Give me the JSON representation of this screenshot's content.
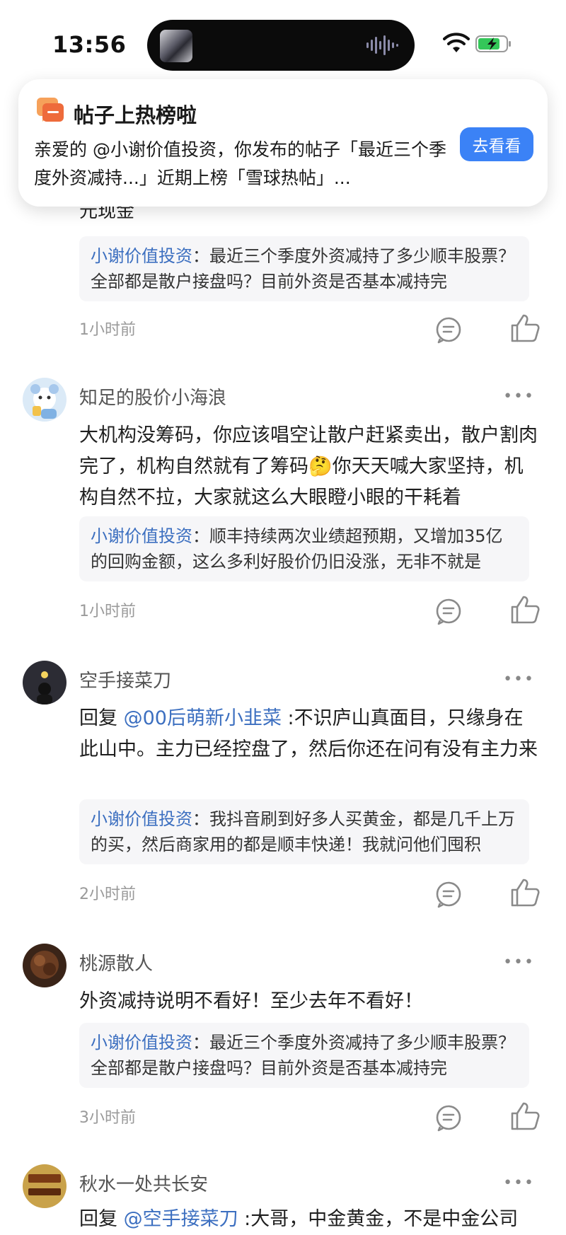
{
  "status_bar": {
    "time": "13:56"
  },
  "notification": {
    "title": "帖子上热榜啦",
    "body": "亲爱的 @小谢价值投资，你发布的帖子「最近三个季度外资减持...」近期上榜「雪球热帖」...",
    "button_label": "去看看"
  },
  "partial_text": "元现金",
  "comments": [
    {
      "quote_user": "小谢价值投资",
      "quote_text": "最近三个季度外资减持了多少顺丰股票？全部都是散户接盘吗？目前外资是否基本减持完",
      "time": "1小时前"
    },
    {
      "author": "知足的股价小海浪",
      "text_part1": "大机构没筹码，你应该唱空让散户赶紧卖出，散户割肉完了，机构自然就有了筹码",
      "emoji": "🤔",
      "text_part2": "你天天喊大家坚持，机构自然不拉，大家就这么大眼瞪小眼的干耗着",
      "quote_user": "小谢价值投资",
      "quote_text": "顺丰持续两次业绩超预期，又增加35亿的回购金额，这么多利好股价仍旧没涨，无非不就是",
      "time": "1小时前"
    },
    {
      "author": "空手接菜刀",
      "reply_prefix": "回复 ",
      "reply_to": "@00后萌新小韭菜",
      "text": " :不识庐山真面目，只缘身在此山中。主力已经控盘了，然后你还在问有没有主力来",
      "quote_user": "小谢价值投资",
      "quote_text": "我抖音刷到好多人买黄金，都是几千上万的买，然后商家用的都是顺丰快递！我就问他们囤积",
      "time": "2小时前"
    },
    {
      "author": "桃源散人",
      "text": "外资减持说明不看好！至少去年不看好！",
      "quote_user": "小谢价值投资",
      "quote_text": "最近三个季度外资减持了多少顺丰股票？全部都是散户接盘吗？目前外资是否基本减持完",
      "time": "3小时前"
    },
    {
      "author": "秋水一处共长安",
      "reply_prefix": "回复 ",
      "reply_to": "@空手接菜刀",
      "text": " :大哥，中金黄金，不是中金公司"
    }
  ],
  "more_label": "•••",
  "colon": "："
}
